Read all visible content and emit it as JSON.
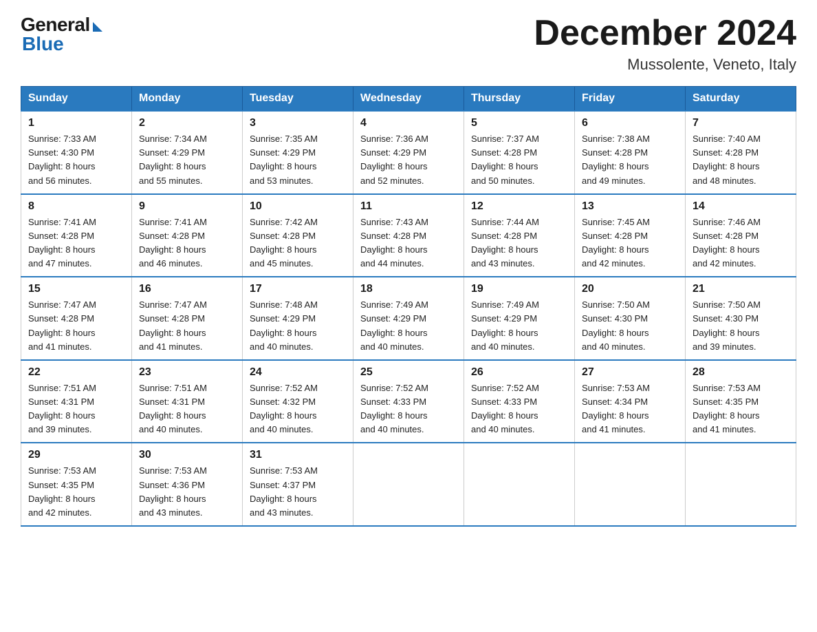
{
  "header": {
    "logo_general": "General",
    "logo_blue": "Blue",
    "month_title": "December 2024",
    "location": "Mussolente, Veneto, Italy"
  },
  "days_of_week": [
    "Sunday",
    "Monday",
    "Tuesday",
    "Wednesday",
    "Thursday",
    "Friday",
    "Saturday"
  ],
  "weeks": [
    [
      {
        "day": "1",
        "sunrise": "7:33 AM",
        "sunset": "4:30 PM",
        "daylight": "8 hours and 56 minutes."
      },
      {
        "day": "2",
        "sunrise": "7:34 AM",
        "sunset": "4:29 PM",
        "daylight": "8 hours and 55 minutes."
      },
      {
        "day": "3",
        "sunrise": "7:35 AM",
        "sunset": "4:29 PM",
        "daylight": "8 hours and 53 minutes."
      },
      {
        "day": "4",
        "sunrise": "7:36 AM",
        "sunset": "4:29 PM",
        "daylight": "8 hours and 52 minutes."
      },
      {
        "day": "5",
        "sunrise": "7:37 AM",
        "sunset": "4:28 PM",
        "daylight": "8 hours and 50 minutes."
      },
      {
        "day": "6",
        "sunrise": "7:38 AM",
        "sunset": "4:28 PM",
        "daylight": "8 hours and 49 minutes."
      },
      {
        "day": "7",
        "sunrise": "7:40 AM",
        "sunset": "4:28 PM",
        "daylight": "8 hours and 48 minutes."
      }
    ],
    [
      {
        "day": "8",
        "sunrise": "7:41 AM",
        "sunset": "4:28 PM",
        "daylight": "8 hours and 47 minutes."
      },
      {
        "day": "9",
        "sunrise": "7:41 AM",
        "sunset": "4:28 PM",
        "daylight": "8 hours and 46 minutes."
      },
      {
        "day": "10",
        "sunrise": "7:42 AM",
        "sunset": "4:28 PM",
        "daylight": "8 hours and 45 minutes."
      },
      {
        "day": "11",
        "sunrise": "7:43 AM",
        "sunset": "4:28 PM",
        "daylight": "8 hours and 44 minutes."
      },
      {
        "day": "12",
        "sunrise": "7:44 AM",
        "sunset": "4:28 PM",
        "daylight": "8 hours and 43 minutes."
      },
      {
        "day": "13",
        "sunrise": "7:45 AM",
        "sunset": "4:28 PM",
        "daylight": "8 hours and 42 minutes."
      },
      {
        "day": "14",
        "sunrise": "7:46 AM",
        "sunset": "4:28 PM",
        "daylight": "8 hours and 42 minutes."
      }
    ],
    [
      {
        "day": "15",
        "sunrise": "7:47 AM",
        "sunset": "4:28 PM",
        "daylight": "8 hours and 41 minutes."
      },
      {
        "day": "16",
        "sunrise": "7:47 AM",
        "sunset": "4:28 PM",
        "daylight": "8 hours and 41 minutes."
      },
      {
        "day": "17",
        "sunrise": "7:48 AM",
        "sunset": "4:29 PM",
        "daylight": "8 hours and 40 minutes."
      },
      {
        "day": "18",
        "sunrise": "7:49 AM",
        "sunset": "4:29 PM",
        "daylight": "8 hours and 40 minutes."
      },
      {
        "day": "19",
        "sunrise": "7:49 AM",
        "sunset": "4:29 PM",
        "daylight": "8 hours and 40 minutes."
      },
      {
        "day": "20",
        "sunrise": "7:50 AM",
        "sunset": "4:30 PM",
        "daylight": "8 hours and 40 minutes."
      },
      {
        "day": "21",
        "sunrise": "7:50 AM",
        "sunset": "4:30 PM",
        "daylight": "8 hours and 39 minutes."
      }
    ],
    [
      {
        "day": "22",
        "sunrise": "7:51 AM",
        "sunset": "4:31 PM",
        "daylight": "8 hours and 39 minutes."
      },
      {
        "day": "23",
        "sunrise": "7:51 AM",
        "sunset": "4:31 PM",
        "daylight": "8 hours and 40 minutes."
      },
      {
        "day": "24",
        "sunrise": "7:52 AM",
        "sunset": "4:32 PM",
        "daylight": "8 hours and 40 minutes."
      },
      {
        "day": "25",
        "sunrise": "7:52 AM",
        "sunset": "4:33 PM",
        "daylight": "8 hours and 40 minutes."
      },
      {
        "day": "26",
        "sunrise": "7:52 AM",
        "sunset": "4:33 PM",
        "daylight": "8 hours and 40 minutes."
      },
      {
        "day": "27",
        "sunrise": "7:53 AM",
        "sunset": "4:34 PM",
        "daylight": "8 hours and 41 minutes."
      },
      {
        "day": "28",
        "sunrise": "7:53 AM",
        "sunset": "4:35 PM",
        "daylight": "8 hours and 41 minutes."
      }
    ],
    [
      {
        "day": "29",
        "sunrise": "7:53 AM",
        "sunset": "4:35 PM",
        "daylight": "8 hours and 42 minutes."
      },
      {
        "day": "30",
        "sunrise": "7:53 AM",
        "sunset": "4:36 PM",
        "daylight": "8 hours and 43 minutes."
      },
      {
        "day": "31",
        "sunrise": "7:53 AM",
        "sunset": "4:37 PM",
        "daylight": "8 hours and 43 minutes."
      },
      null,
      null,
      null,
      null
    ]
  ],
  "labels": {
    "sunrise": "Sunrise:",
    "sunset": "Sunset:",
    "daylight": "Daylight:"
  }
}
